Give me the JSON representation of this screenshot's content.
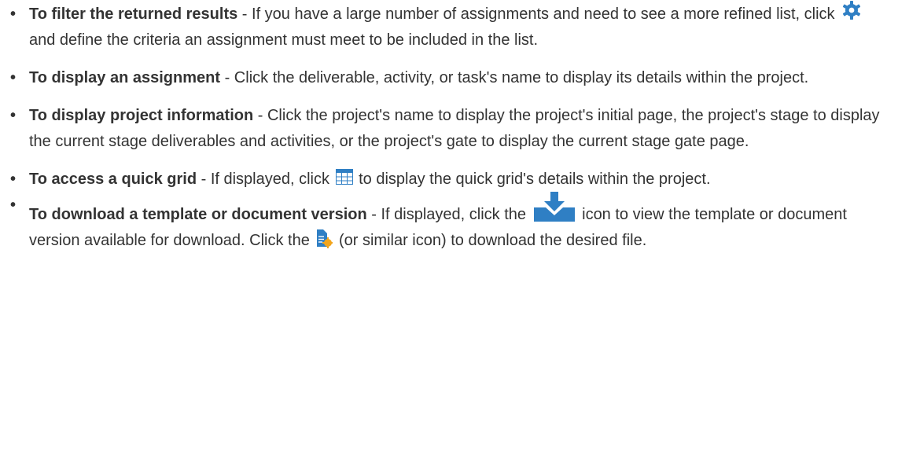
{
  "bullet_char": "•",
  "colors": {
    "icon_blue": "#2f7fc4",
    "icon_orange": "#f2a51d",
    "text": "#333333"
  },
  "items": [
    {
      "title": "To filter the returned results",
      "text_a": " - If you have a large number of assignments and need to see a more refined list, click ",
      "icon": "gear-icon",
      "text_b": " and define the criteria an assignment must meet to be included in the list."
    },
    {
      "title": "To display an assignment",
      "text_a": " - Click the deliverable, activity, or task's name to display its details within the project."
    },
    {
      "title": "To display project information",
      "text_a": " - Click the project's name to display the project's initial page, the project's stage to display the current stage deliverables and activities, or the project's gate to display the current stage gate page."
    },
    {
      "title": "To access a quick grid",
      "text_a": " - If displayed, click ",
      "icon": "grid-icon",
      "text_b": " to display the quick grid's details within the project."
    },
    {
      "title": "To download a template or document version",
      "text_a": " - If displayed, click the ",
      "icon": "download-icon",
      "text_b": " icon to view the template or document version available for download. Click the ",
      "icon2": "document-star-icon",
      "text_c": " (or similar icon) to download the desired file."
    }
  ]
}
